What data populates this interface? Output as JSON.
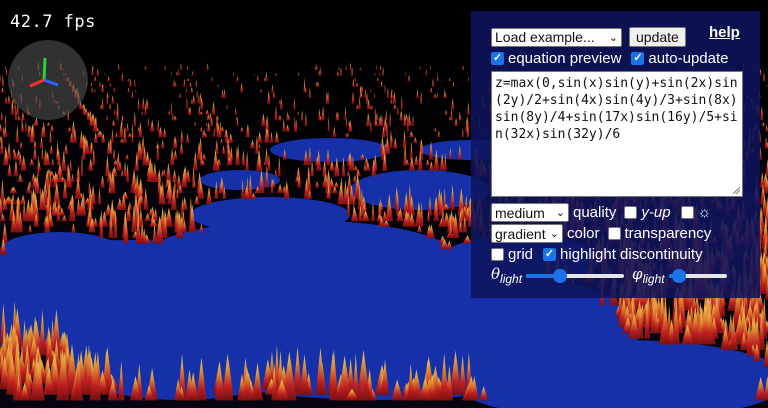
{
  "fps": "42.7 fps",
  "panel": {
    "example_select": "Load example...",
    "update_label": "update",
    "help_label": "help",
    "equation_preview_label": "equation preview",
    "equation_preview_checked": true,
    "auto_update_label": "auto-update",
    "auto_update_checked": true,
    "equation": "z=max(0,sin(x)sin(y)+sin(2x)sin(2y)/2+sin(4x)sin(4y)/3+sin(8x)sin(8y)/4+sin(17x)sin(16y)/5+sin(32x)sin(32y)/6",
    "quality_select": "medium",
    "quality_label": "quality",
    "y_up_label": "y-up",
    "y_up_checked": false,
    "light_icon_checked": false,
    "color_select": "gradient",
    "color_label": "color",
    "transparency_label": "transparency",
    "transparency_checked": false,
    "grid_label": "grid",
    "grid_checked": false,
    "highlight_label": "highlight discontinuity",
    "highlight_checked": true,
    "theta_symbol": "θ",
    "phi_symbol": "φ",
    "light_subscript": "light",
    "theta_value": 0.35,
    "phi_value": 0.18
  },
  "colors": {
    "panel_bg": "#0e145c",
    "accent": "#1a73e8",
    "terrain_blue": "#1530a8",
    "peak_red": "#c01818",
    "peak_yellow": "#f0c040"
  }
}
